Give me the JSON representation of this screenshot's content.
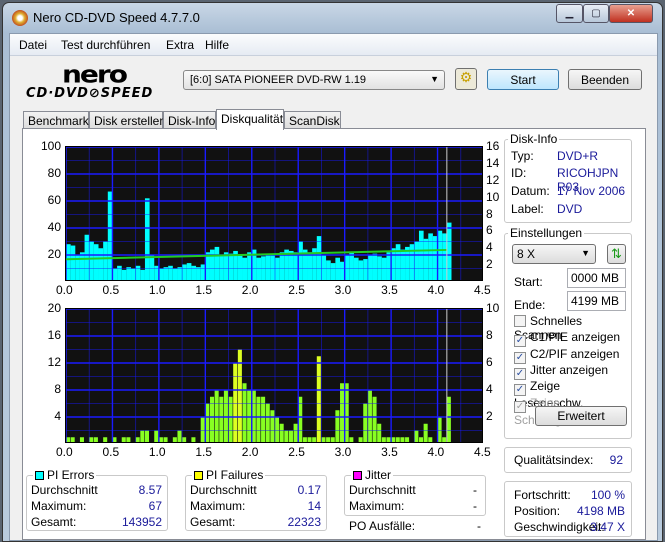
{
  "window": {
    "title": "Nero CD-DVD Speed 4.7.7.0"
  },
  "menu": [
    "Datei",
    "Test durchführen",
    "Extra",
    "Hilfe"
  ],
  "logo": {
    "top": "nero",
    "bottom": "CD·DVD⊘SPEED"
  },
  "toolbar": {
    "drive": "[6:0]  SATA PIONEER DVD-RW 1.19",
    "start": "Start",
    "exit": "Beenden"
  },
  "tabs": [
    "Benchmark",
    "Disk erstellen",
    "Disk-Info",
    "Diskqualität",
    "ScanDisk"
  ],
  "disk_info": {
    "title": "Disk-Info",
    "type_label": "Typ:",
    "type": "DVD+R",
    "id_label": "ID:",
    "id": "RICOHJPN R03",
    "date_label": "Datum:",
    "date": "17 Nov 2006",
    "label_label": "Label:",
    "label": "DVD"
  },
  "settings": {
    "title": "Einstellungen",
    "speed": "8 X",
    "start_label": "Start:",
    "start": "0000 MB",
    "end_label": "Ende:",
    "end": "4199 MB",
    "checks": [
      {
        "label": "Schnelles Scannen",
        "checked": false,
        "disabled": false
      },
      {
        "label": "C1/PIE anzeigen",
        "checked": true,
        "disabled": false
      },
      {
        "label": "C2/PIF anzeigen",
        "checked": true,
        "disabled": false
      },
      {
        "label": "Jitter anzeigen",
        "checked": true,
        "disabled": false
      },
      {
        "label": "Zeige Lesegeschw.",
        "checked": true,
        "disabled": false
      },
      {
        "label": "Zeige Schreibgeschw.",
        "checked": true,
        "disabled": true
      }
    ],
    "advanced": "Erweitert"
  },
  "quality": {
    "label": "Qualitätsindex:",
    "value": "92"
  },
  "progress": {
    "progress_label": "Fortschritt:",
    "progress": "100 %",
    "position_label": "Position:",
    "position": "4198 MB",
    "speed_label": "Geschwindigkeit:",
    "speed": "3.47 X"
  },
  "stats": {
    "pie": {
      "title": "PI Errors",
      "color": "#00ffff",
      "avg_label": "Durchschnitt",
      "avg": "8.57",
      "max_label": "Maximum:",
      "max": "67",
      "total_label": "Gesamt:",
      "total": "143952"
    },
    "pif": {
      "title": "PI Failures",
      "color": "#ffff00",
      "avg_label": "Durchschnitt",
      "avg": "0.17",
      "max_label": "Maximum:",
      "max": "14",
      "total_label": "Gesamt:",
      "total": "22323"
    },
    "jitter": {
      "title": "Jitter",
      "color": "#ff00ff",
      "avg_label": "Durchschnitt",
      "avg": "-",
      "max_label": "Maximum:",
      "max": "-",
      "po_label": "PO Ausfälle:",
      "po": "-"
    }
  },
  "chart_data": [
    {
      "type": "bar",
      "title": "PI Errors",
      "xlim": [
        0,
        4.5
      ],
      "ylim": [
        0,
        100
      ],
      "y2lim": [
        0,
        16
      ],
      "xticks": [
        "0.0",
        "0.5",
        "1.0",
        "1.5",
        "2.0",
        "2.5",
        "3.0",
        "3.5",
        "4.0",
        "4.5"
      ],
      "yticks": [
        "100",
        "80",
        "60",
        "40",
        "20"
      ],
      "y2ticks": [
        "16",
        "14",
        "12",
        "10",
        "8",
        "6",
        "4",
        "2"
      ],
      "x_step": 0.05,
      "values": [
        28,
        27,
        20,
        22,
        35,
        30,
        28,
        25,
        30,
        67,
        10,
        12,
        9,
        11,
        10,
        12,
        9,
        62,
        20,
        12,
        10,
        11,
        12,
        10,
        11,
        13,
        14,
        12,
        11,
        13,
        22,
        24,
        26,
        20,
        22,
        21,
        23,
        20,
        18,
        22,
        24,
        18,
        19,
        20,
        21,
        18,
        22,
        24,
        23,
        22,
        30,
        24,
        22,
        25,
        34,
        20,
        16,
        14,
        18,
        15,
        20,
        22,
        18,
        16,
        17,
        20,
        21,
        19,
        18,
        22,
        25,
        28,
        24,
        26,
        28,
        30,
        38,
        32,
        36,
        34,
        38,
        36,
        44
      ],
      "read_speed": {
        "x": [
          0,
          4.1
        ],
        "y": [
          2.7,
          3.8
        ]
      },
      "end_marker": 4.1,
      "bar_color": "#00ffff",
      "speed_color": "#22cc22"
    },
    {
      "type": "bar",
      "title": "PI Failures",
      "xlim": [
        0,
        4.5
      ],
      "ylim": [
        0,
        20
      ],
      "y2lim": [
        0,
        10
      ],
      "xticks": [
        "0.0",
        "0.5",
        "1.0",
        "1.5",
        "2.0",
        "2.5",
        "3.0",
        "3.5",
        "4.0",
        "4.5"
      ],
      "yticks": [
        "20",
        "16",
        "12",
        "8",
        "4"
      ],
      "y2ticks": [
        "10",
        "8",
        "6",
        "4",
        "2"
      ],
      "x_step": 0.05,
      "values": [
        1,
        1,
        0,
        1,
        0,
        1,
        1,
        0,
        1,
        0,
        1,
        0,
        1,
        1,
        0,
        1,
        2,
        2,
        0,
        2,
        1,
        1,
        0,
        1,
        2,
        1,
        0,
        1,
        0,
        4,
        6,
        7,
        8,
        7,
        8,
        7,
        12,
        14,
        9,
        8,
        8,
        7,
        7,
        6,
        5,
        4,
        3,
        2,
        2,
        3,
        7,
        1,
        1,
        1,
        13,
        1,
        1,
        1,
        5,
        9,
        9,
        1,
        0,
        1,
        6,
        8,
        7,
        3,
        1,
        1,
        1,
        1,
        1,
        1,
        0,
        2,
        1,
        3,
        1,
        0,
        4,
        1,
        7
      ],
      "end_marker": 4.1,
      "bar_color": "#88ff22"
    }
  ]
}
